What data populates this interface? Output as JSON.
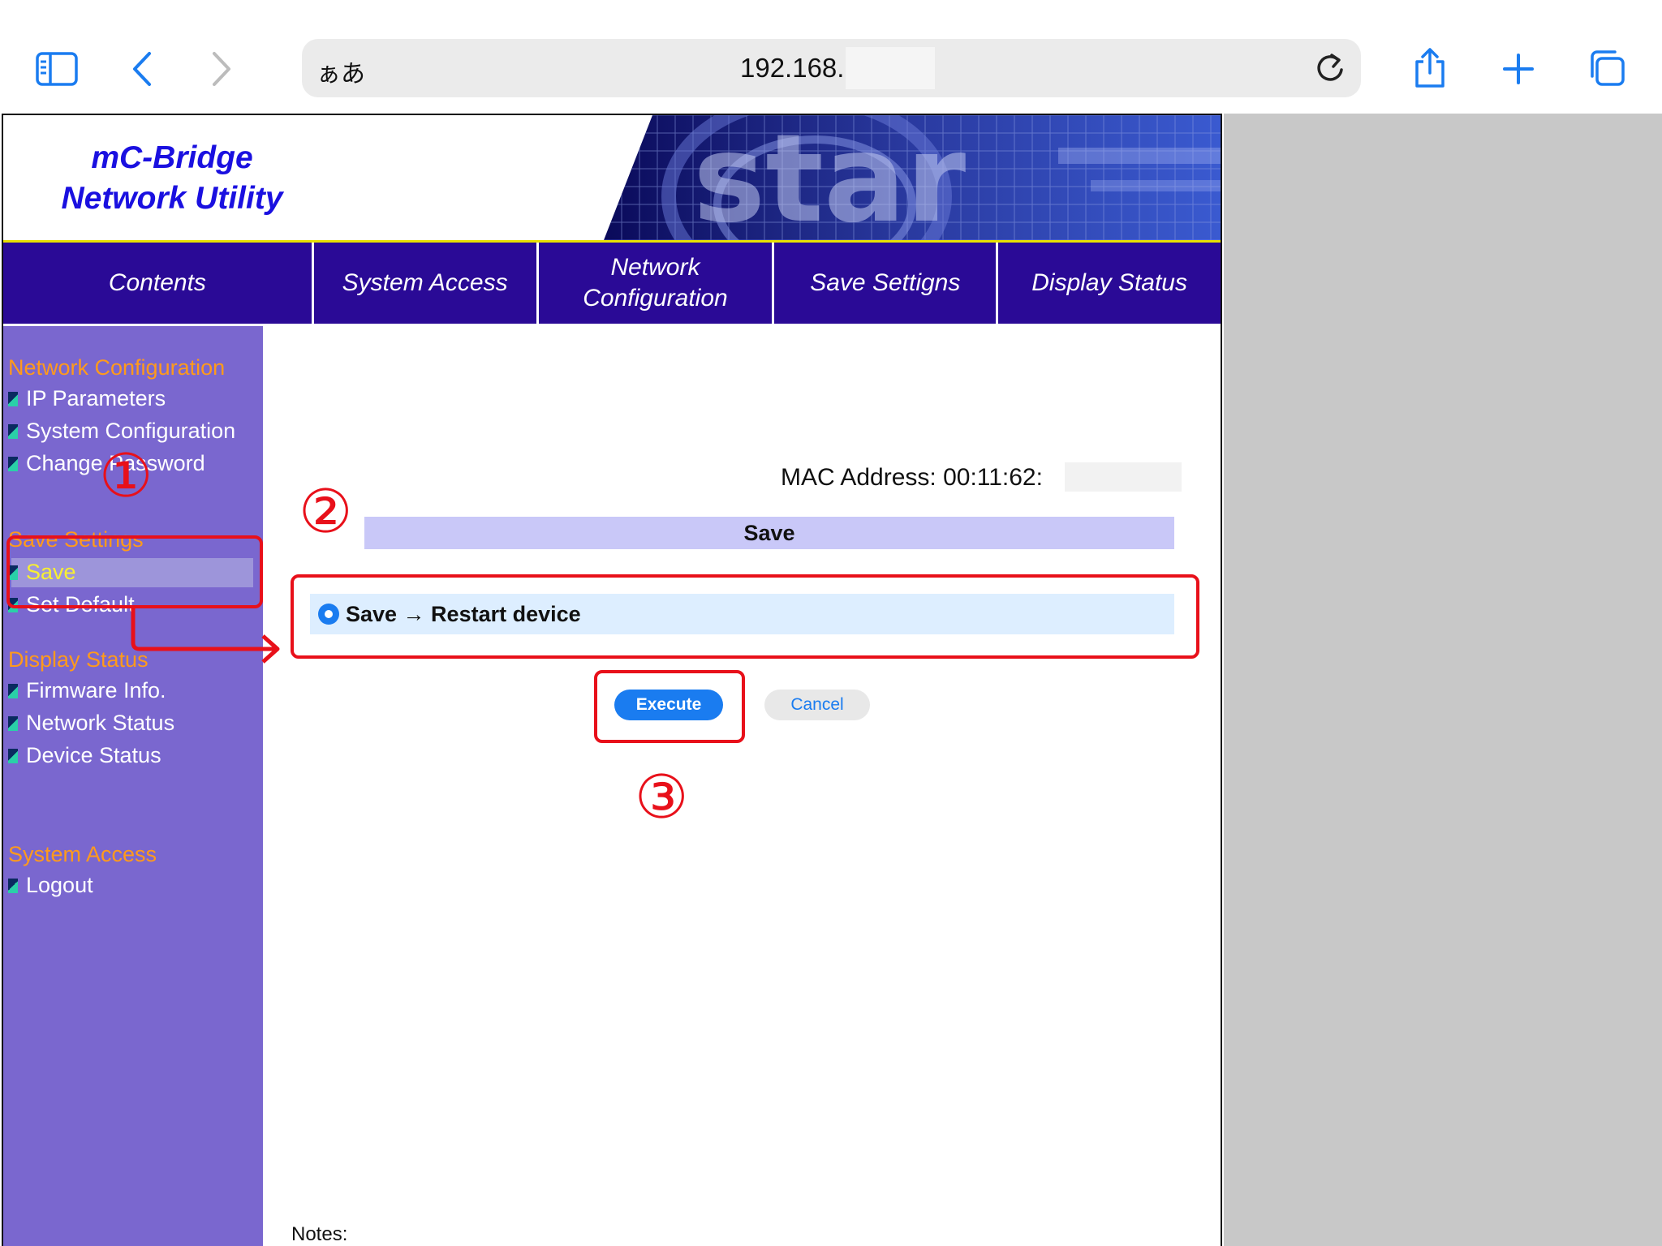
{
  "browser": {
    "aa_label": "ぁあ",
    "url": "192.168."
  },
  "header": {
    "logo_line1": "mC-Bridge",
    "logo_line2": "Network Utility"
  },
  "topnav": {
    "tabs": [
      {
        "label": "Contents"
      },
      {
        "label": "System Access"
      },
      {
        "label": "Network Configuration"
      },
      {
        "label": "Save Settigns"
      },
      {
        "label": "Display Status"
      }
    ]
  },
  "sidebar": {
    "sections": [
      {
        "title": "Network Configuration",
        "items": [
          "IP Parameters",
          "System Configuration",
          "Change Password"
        ]
      },
      {
        "title": "Save Settings",
        "items": [
          "Save",
          "Set Default"
        ]
      },
      {
        "title": "Display Status",
        "items": [
          "Firmware Info.",
          "Network Status",
          "Device Status"
        ]
      },
      {
        "title": "System Access",
        "items": [
          "Logout"
        ]
      }
    ]
  },
  "main": {
    "mac_label": "MAC Address: 00:11:62:",
    "save_header": "Save",
    "option_label": "Save → Restart device",
    "execute_label": "Execute",
    "cancel_label": "Cancel",
    "notes_label": "Notes:"
  },
  "annotations": {
    "step1": "①",
    "step2": "②",
    "step3": "③"
  },
  "colors": {
    "nav_bg": "#2a0a96",
    "sidebar_bg": "#7a67cf",
    "section_title": "#ff9a1c",
    "accent": "#1a7cf0",
    "annotation": "#e8101a"
  }
}
